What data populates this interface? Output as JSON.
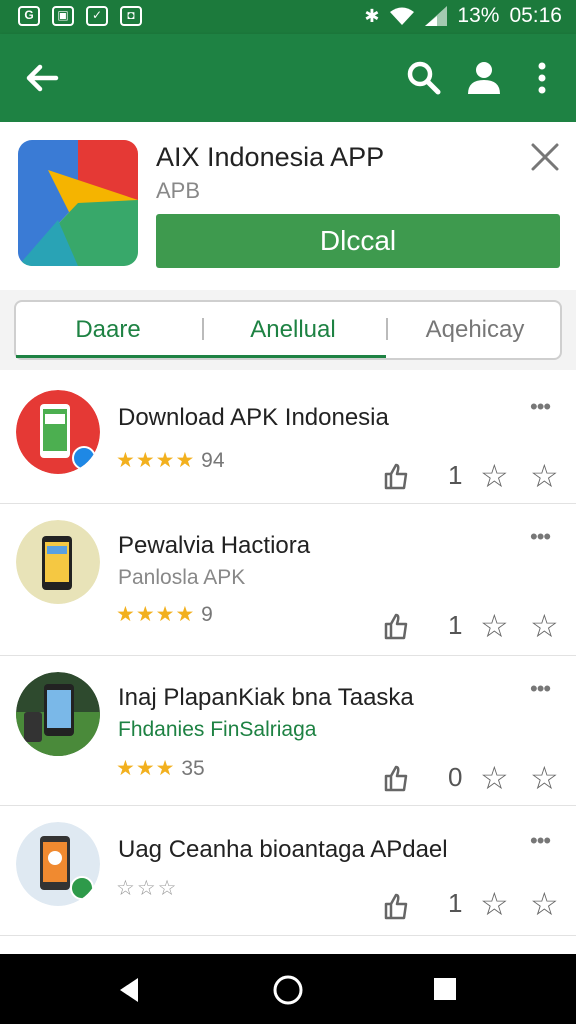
{
  "status_bar": {
    "left_icons": [
      "G",
      "▣",
      "✓",
      "◘"
    ],
    "battery": "13%",
    "time": "05:16"
  },
  "app_bar": {
    "icons": [
      "back-arrow-icon",
      "search-icon",
      "account-icon",
      "more-vert-icon"
    ]
  },
  "header": {
    "title": "AIX Indonesia APP",
    "subtitle": "APB",
    "button_label": "Dlccal"
  },
  "tabs": [
    {
      "label": "Daare",
      "active": true
    },
    {
      "label": "Anellual",
      "active": false
    },
    {
      "label": "Aqehicay",
      "active": false
    }
  ],
  "items": [
    {
      "title": "Download APK Indonesia",
      "subtitle": "",
      "stars": "★★★★",
      "rating": "94",
      "count": "1"
    },
    {
      "title": "Pewalvia Hactiora",
      "subtitle": "Panlosla APK",
      "stars": "★★★★",
      "rating": "9",
      "count": "1"
    },
    {
      "title": "Inaj PlapanKiak bna Taaska",
      "subtitle": "Fhdanies FinSalriaga",
      "stars": "★★★",
      "rating": "35",
      "count": "0"
    },
    {
      "title": "Uag Ceanha bioantaga APdael",
      "subtitle": "",
      "stars": "",
      "empty_stars": "☆☆☆",
      "rating": "",
      "count": "1"
    }
  ],
  "colors": {
    "primary": "#1e8243",
    "status": "#1c7a3c",
    "install": "#3e9a4e",
    "star": "#f2b01e"
  }
}
